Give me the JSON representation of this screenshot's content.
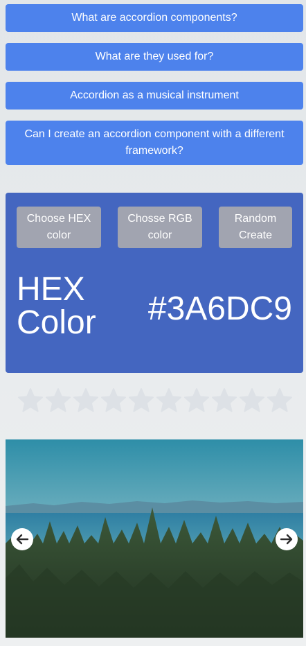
{
  "accordion": {
    "items": [
      {
        "label": "What are accordion components?"
      },
      {
        "label": "What are they used for?"
      },
      {
        "label": "Accordion as a musical instrument"
      },
      {
        "label": "Can I create an accordion component with a different framework?"
      }
    ]
  },
  "color_generator": {
    "buttons": {
      "hex": "Choose HEX color",
      "rgb": "Chosse RGB color",
      "random": "Random Create"
    },
    "mode_label": "HEX Color",
    "value": "#3A6DC9",
    "background_color": "#4466C0"
  },
  "rating": {
    "star_count": 10,
    "selected": 0,
    "empty_color": "#dde1e6"
  },
  "carousel": {
    "image": "forest-and-sea-landscape",
    "prev_icon": "arrow-left-icon",
    "next_icon": "arrow-right-icon"
  }
}
